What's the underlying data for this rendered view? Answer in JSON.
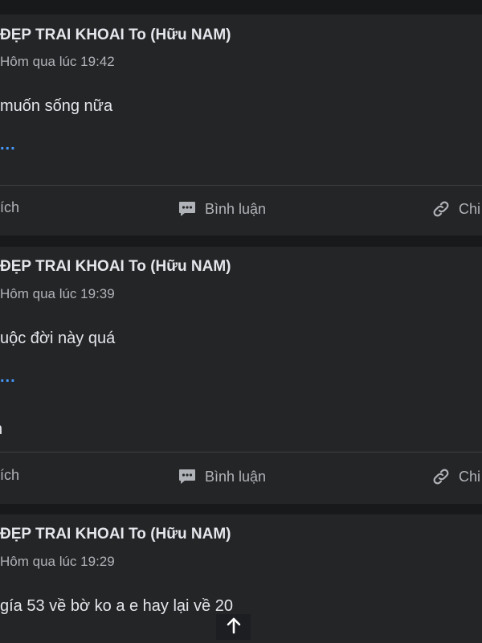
{
  "posts": [
    {
      "author": "ĐẸP TRAI KHOAI To (Hữu NAM)",
      "time": "Hôm qua lúc 19:42",
      "text": "muốn sống nữa",
      "more": "...",
      "extra": "",
      "actions": {
        "like": "ích",
        "comment": "Bình luận",
        "share": "Chi"
      }
    },
    {
      "author": "ĐẸP TRAI KHOAI To (Hữu NAM)",
      "time": "Hôm qua lúc 19:39",
      "text": "uộc đời này quá",
      "more": "...",
      "extra": "n",
      "actions": {
        "like": "ích",
        "comment": "Bình luận",
        "share": "Chi"
      }
    },
    {
      "author": "ĐẸP TRAI KHOAI To (Hữu NAM)",
      "time": "Hôm qua lúc 19:29",
      "text": " gía 53 về bờ ko a e hay lại về 20",
      "more": "",
      "extra": "",
      "actions": {
        "like": "",
        "comment": "",
        "share": ""
      }
    }
  ],
  "icons": {
    "comment": "comment-icon",
    "link": "link-icon",
    "scroll_top": "arrow-up-icon"
  },
  "colors": {
    "background": "#18191a",
    "card": "#242526",
    "text_primary": "#e4e6eb",
    "text_secondary": "#b0b3b8",
    "accent": "#4599ff"
  }
}
